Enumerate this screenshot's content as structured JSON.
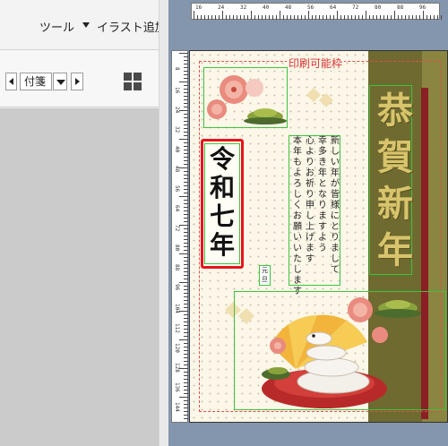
{
  "menu": {
    "tool_label": "ツール",
    "illust_label": "イラスト追加"
  },
  "toolbar": {
    "tag_select_value": "付箋"
  },
  "card": {
    "printable_area_label": "印刷可能枠",
    "greeting_chars": [
      "恭",
      "賀",
      "新",
      "年"
    ],
    "reiwa_chars": [
      "令",
      "和",
      "七",
      "年"
    ],
    "message_columns": [
      "新しい年が皆様にとりまして",
      "幸多き年となりますよう",
      "心よりお祈り申し上げます",
      "本年もよろしくお願いいたします"
    ],
    "gantan_label": "元旦"
  },
  "ruler": {
    "top_labels": [
      "16",
      "24",
      "32",
      "40",
      "48",
      "56",
      "64",
      "72",
      "80",
      "88",
      "96"
    ],
    "left_labels": [
      "8",
      "16",
      "24",
      "32",
      "40",
      "48",
      "56",
      "64",
      "72",
      "80",
      "88",
      "96",
      "104",
      "112",
      "120",
      "128",
      "136",
      "144"
    ]
  },
  "colors": {
    "accent_red": "#e8141c",
    "selection_green": "#3cc43c",
    "card_gold": "#d8c46c",
    "band_olive": "#6f6a30"
  }
}
